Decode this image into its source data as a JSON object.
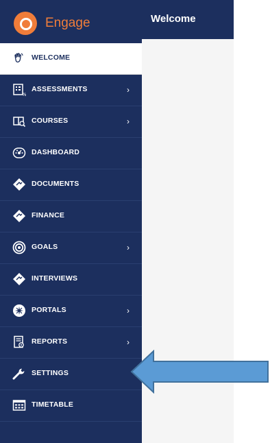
{
  "brand": {
    "name": "Engage"
  },
  "header": {
    "title": "Welcome"
  },
  "nav": {
    "items": [
      {
        "label": "WELCOME",
        "icon": "hand-wave-icon",
        "active": true,
        "has_submenu": false
      },
      {
        "label": "ASSESSMENTS",
        "icon": "assessment-icon",
        "active": false,
        "has_submenu": true
      },
      {
        "label": "COURSES",
        "icon": "book-icon",
        "active": false,
        "has_submenu": true
      },
      {
        "label": "DASHBOARD",
        "icon": "gauge-icon",
        "active": false,
        "has_submenu": false
      },
      {
        "label": "DOCUMENTS",
        "icon": "diamond-icon",
        "active": false,
        "has_submenu": false
      },
      {
        "label": "FINANCE",
        "icon": "diamond-icon",
        "active": false,
        "has_submenu": false
      },
      {
        "label": "GOALS",
        "icon": "target-icon",
        "active": false,
        "has_submenu": true
      },
      {
        "label": "INTERVIEWS",
        "icon": "diamond-icon",
        "active": false,
        "has_submenu": false
      },
      {
        "label": "PORTALS",
        "icon": "portal-icon",
        "active": false,
        "has_submenu": true
      },
      {
        "label": "REPORTS",
        "icon": "report-icon",
        "active": false,
        "has_submenu": true
      },
      {
        "label": "SETTINGS",
        "icon": "wrench-icon",
        "active": false,
        "has_submenu": false
      },
      {
        "label": "TIMETABLE",
        "icon": "calendar-grid-icon",
        "active": false,
        "has_submenu": false
      }
    ],
    "chevron": "›"
  },
  "colors": {
    "sidebar_bg": "#1c2f5e",
    "brand_accent": "#f07d3a",
    "annotation_arrow": "#5b9bd5"
  }
}
